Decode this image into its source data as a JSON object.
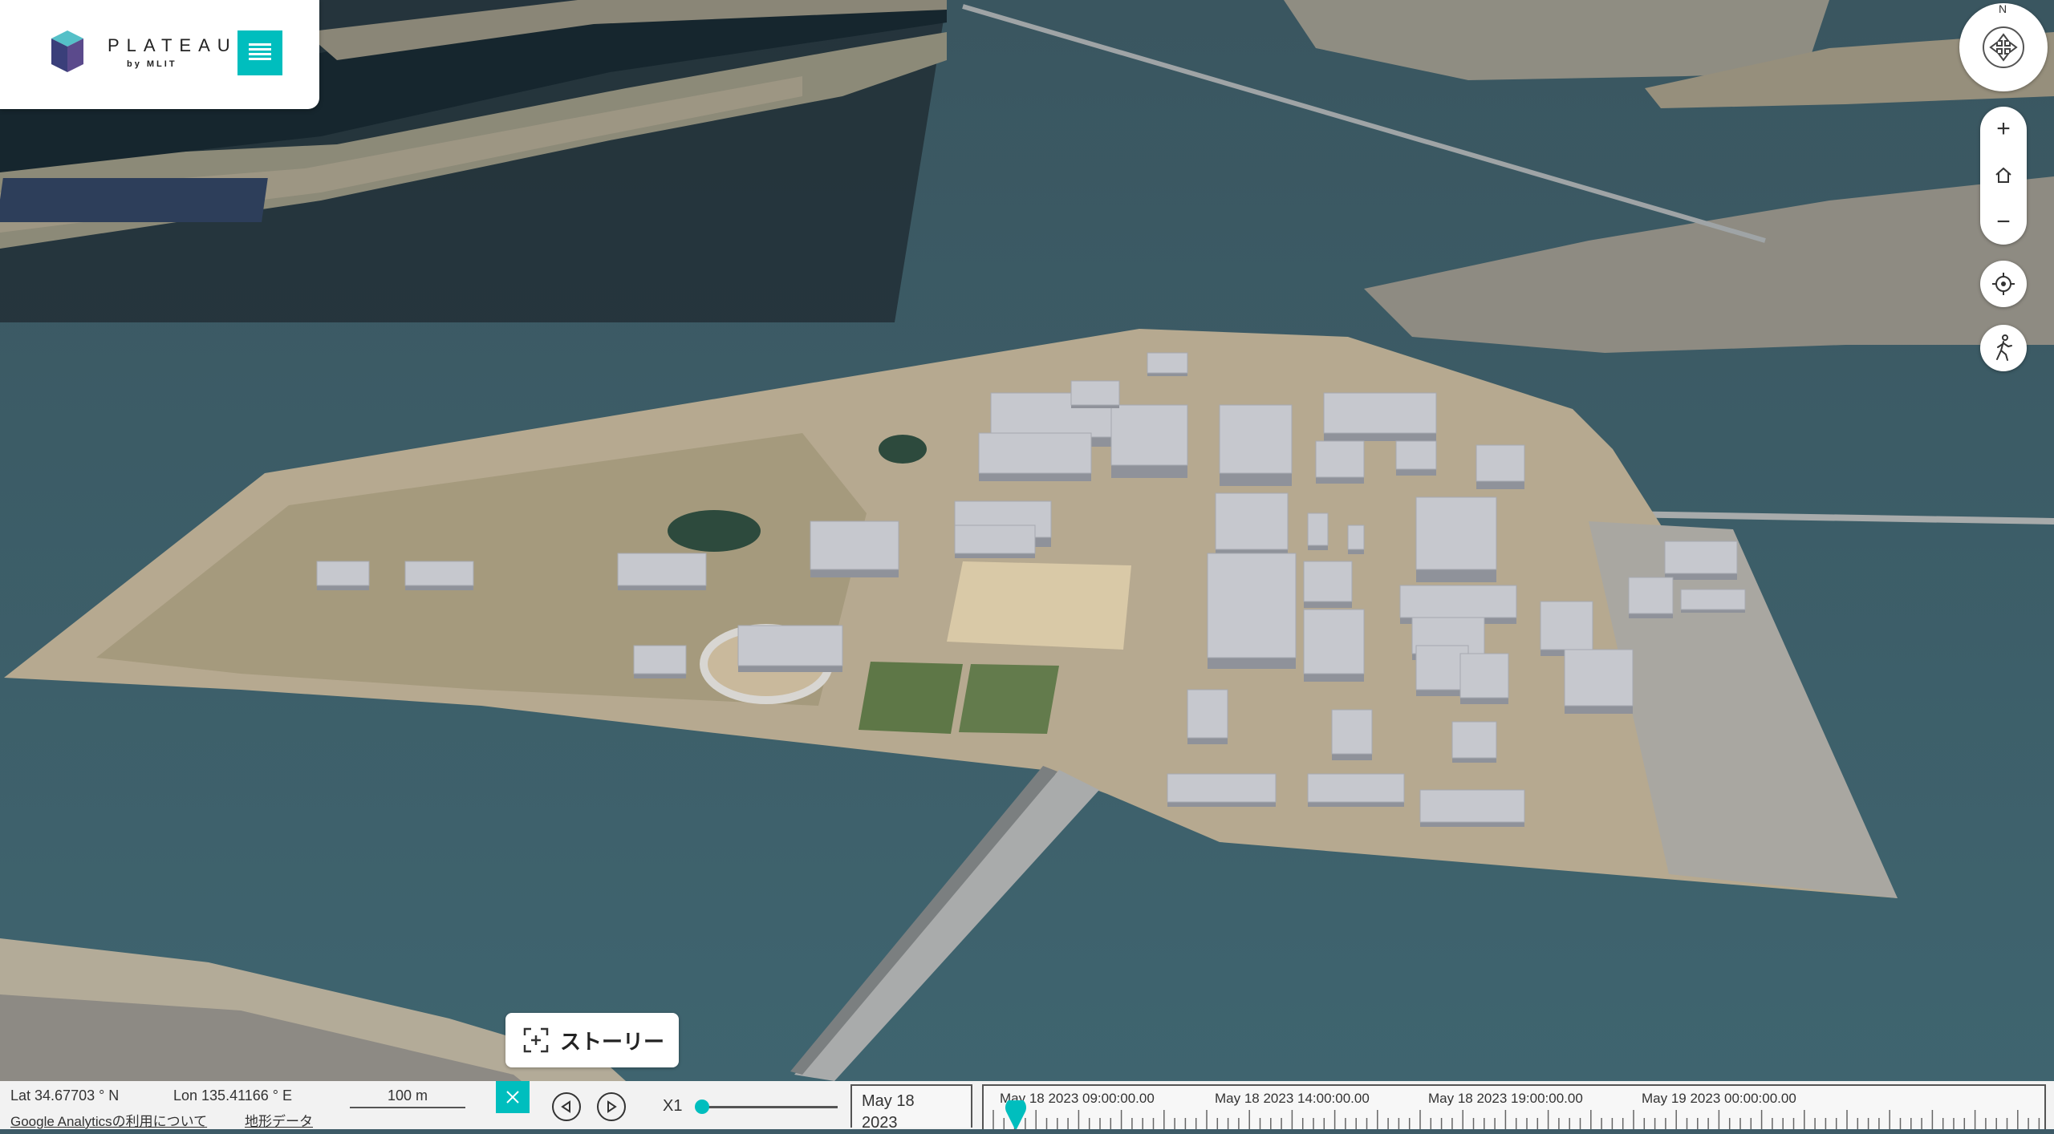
{
  "app": {
    "logo_text": "PLATEAU",
    "logo_subtext": "by MLIT"
  },
  "colors": {
    "accent": "#00bebe",
    "water": "#3f5d68",
    "land": "#b8ab92",
    "building": "#c7c9cf"
  },
  "controls": {
    "compass_north": "N",
    "zoom_in_icon": "plus-icon",
    "home_icon": "home-icon",
    "zoom_out_icon": "minus-icon",
    "locate_icon": "crosshair-icon",
    "pedestrian_icon": "walking-person-icon"
  },
  "story": {
    "label": "ストーリー"
  },
  "status": {
    "lat": "Lat 34.67703 ° N",
    "lon": "Lon 135.41166 ° E",
    "scale": "100 m",
    "ga_link": "Google Analyticsの利用について",
    "terrain_link": "地形データ"
  },
  "timeline": {
    "speed": "X1",
    "speed_level": 0,
    "date_line1": "May 18",
    "date_line2": "2023",
    "labels": [
      "May 18 2023 09:00:00.00",
      "May 18 2023 14:00:00.00",
      "May 18 2023 19:00:00.00",
      "May 19 2023 00:00:00.00"
    ]
  }
}
